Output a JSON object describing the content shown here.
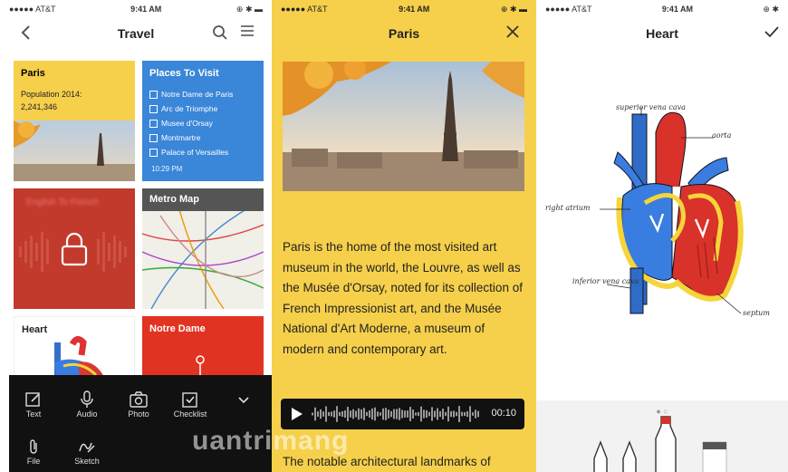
{
  "screen1": {
    "status": {
      "carrier": "●●●●● AT&T",
      "time": "9:41 AM",
      "right": "⊕ ✱ ▬"
    },
    "title": "Travel",
    "cards": {
      "paris": {
        "title": "Paris",
        "line1": "Population 2014:",
        "line2": "2,241,346"
      },
      "places": {
        "title": "Places To Visit",
        "items": [
          "Notre Dame de Paris",
          "Arc de Triomphe",
          "Musee d'Orsay",
          "Montmartre",
          "Palace of Versailles"
        ],
        "time": "10:29 PM"
      },
      "locked": {
        "title": "English To French"
      },
      "metro": {
        "title": "Metro Map"
      },
      "heart": {
        "title": "Heart"
      },
      "notre_dame": {
        "title": "Notre Dame"
      }
    },
    "toolbar": {
      "text": "Text",
      "audio": "Audio",
      "photo": "Photo",
      "checklist": "Checklist",
      "file": "File",
      "sketch": "Sketch"
    }
  },
  "screen2": {
    "status": {
      "carrier": "●●●●● AT&T",
      "time": "9:41 AM",
      "right": "⊕ ✱ ▬"
    },
    "title": "Paris",
    "body": "Paris is the home of the most visited art museum in the world, the Louvre, as well as the Musée d'Orsay, noted for its collection of French Impressionist art, and the Musée National d'Art Moderne, a museum of modern and contemporary art.",
    "audio_duration": "00:10",
    "body2": "The notable architectural landmarks of"
  },
  "screen3": {
    "status": {
      "carrier": "●●●●● AT&T",
      "time": "9:41 AM",
      "right": "⊕ ✱"
    },
    "title": "Heart",
    "labels": {
      "superior": "superior vena cava",
      "aorta": "aorta",
      "right_atrium": "right atrium",
      "inferior": "inferior vena cava",
      "septum": "septum"
    }
  },
  "watermark": "uantrimang",
  "colors": {
    "yellow": "#f6d04b",
    "blue": "#3a86d8",
    "red": "#c23a2c",
    "toolbar": "#111111"
  }
}
